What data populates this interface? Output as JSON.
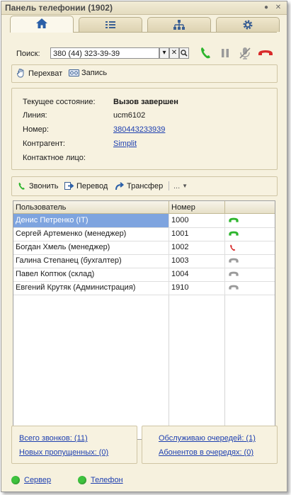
{
  "window": {
    "title": "Панель телефонии (1902)"
  },
  "colors": {
    "accent_green": "#2db52d",
    "hangup_red": "#d82a2a",
    "link": "#1d3fb0",
    "selection": "#7ea4df"
  },
  "tabs": [
    {
      "icon": "home-icon",
      "active": true
    },
    {
      "icon": "list-icon",
      "active": false
    },
    {
      "icon": "hierarchy-icon",
      "active": false
    },
    {
      "icon": "gear-icon",
      "active": false
    }
  ],
  "search": {
    "label": "Поиск:",
    "value": "380 (44) 323-39-39"
  },
  "actions": {
    "intercept": "Перехват",
    "record": "Запись"
  },
  "call_info": {
    "state_label": "Текущее состояние:",
    "state_value": "Вызов завершен",
    "line_label": "Линия:",
    "line_value": "ucm6102",
    "number_label": "Номер:",
    "number_value": "380443233939",
    "contractor_label": "Контрагент:",
    "contractor_value": "Simplit",
    "contact_label": "Контактное лицо:",
    "contact_value": ""
  },
  "toolbar": {
    "call": "Звонить",
    "transfer": "Перевод",
    "transfer2": "Трансфер",
    "more": "..."
  },
  "table": {
    "headers": [
      "Пользователь",
      "Номер"
    ],
    "rows": [
      {
        "user": "Денис Петренко (IT)",
        "number": "1000",
        "status": "green"
      },
      {
        "user": "Сергей Артеменко (менеджер)",
        "number": "1001",
        "status": "green"
      },
      {
        "user": "Богдан Хмель (менеджер)",
        "number": "1002",
        "status": "red"
      },
      {
        "user": "Галина Степанец (бухгалтер)",
        "number": "1003",
        "status": "gray"
      },
      {
        "user": "Павел Коптюк (склад)",
        "number": "1004",
        "status": "gray"
      },
      {
        "user": "Евгений Крутяк (Администрация)",
        "number": "1910",
        "status": "gray"
      }
    ]
  },
  "stats": {
    "total_calls": "Всего звонков: (11)",
    "missed_calls": "Новых пропущенных: (0)",
    "queues": "Обслуживаю очередей: (1)",
    "in_queue": "Абонентов в очередях: (0)"
  },
  "footer": {
    "server": "Сервер",
    "phone": "Телефон"
  }
}
